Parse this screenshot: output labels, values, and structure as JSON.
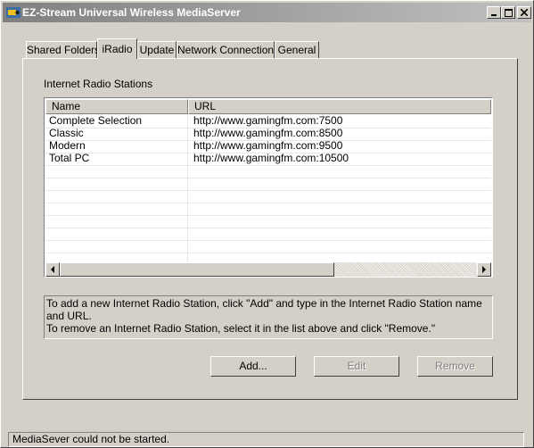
{
  "window": {
    "title": "EZ-Stream Universal Wireless MediaServer",
    "icon": "app-icon",
    "controls": [
      "minimize-icon",
      "maximize-icon",
      "close-icon"
    ]
  },
  "tabs": [
    {
      "label": "Shared Folders",
      "active": false
    },
    {
      "label": "iRadio",
      "active": true
    },
    {
      "label": "Update",
      "active": false
    },
    {
      "label": "Network Connection",
      "active": false
    },
    {
      "label": "General",
      "active": false
    }
  ],
  "iradio": {
    "group_label": "Internet Radio Stations",
    "columns": [
      "Name",
      "URL"
    ],
    "stations": [
      {
        "name": "Complete Selection",
        "url": "http://www.gamingfm.com:7500"
      },
      {
        "name": "Classic",
        "url": "http://www.gamingfm.com:8500"
      },
      {
        "name": "Modern",
        "url": "http://www.gamingfm.com:9500"
      },
      {
        "name": "Total PC",
        "url": "http://www.gamingfm.com:10500"
      }
    ],
    "info_line1": "To add a new Internet Radio Station, click \"Add\" and type in the Internet Radio Station name and URL.",
    "info_line2": "To remove an Internet Radio Station, select it in the list above and click \"Remove.\"",
    "add_label": "Add...",
    "edit_label": "Edit",
    "remove_label": "Remove"
  },
  "status": {
    "text": "MediaSever could not be started."
  },
  "colors": {
    "face": "#d4d0c8",
    "title_start": "#808080",
    "title_end": "#c0c0c0"
  }
}
